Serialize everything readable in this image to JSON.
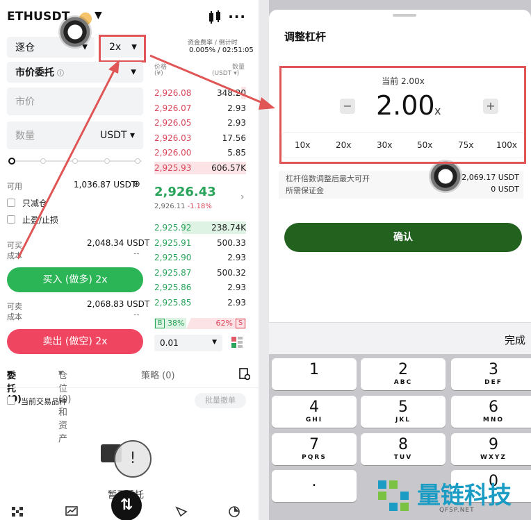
{
  "left": {
    "symbol": "ETHUSDT",
    "margin_mode": "逐仓",
    "leverage": "2x",
    "order_type": "市价委托",
    "funding_label": "资金费率 / 倒计时",
    "funding_value": "0.005% / 02:51:05",
    "price_placeholder": "市价",
    "qty_placeholder": "数量",
    "qty_unit": "USDT",
    "available_label": "可用",
    "available_value": "1,036.87 USDT",
    "reduce_only": "只减仓",
    "tpsl": "止盈/止损",
    "can_buy_label": "可买",
    "can_buy_value": "2,048.34 USDT",
    "cost_label_1": "成本",
    "cost_value_1": "--",
    "buy_button": "买入 (做多) 2x",
    "can_sell_label": "可卖",
    "can_sell_value": "2,068.83 USDT",
    "cost_label_2": "成本",
    "cost_value_2": "--",
    "sell_button": "卖出 (做空) 2x",
    "orderbook": {
      "price_header": "价格",
      "price_unit": "(¥)",
      "qty_header": "数量",
      "qty_unit": "(USDT ▾)",
      "asks": [
        {
          "price": "2,926.08",
          "qty": "348.20",
          "fill": 0.05
        },
        {
          "price": "2,926.07",
          "qty": "2.93",
          "fill": 0.0
        },
        {
          "price": "2,926.05",
          "qty": "2.93",
          "fill": 0.0
        },
        {
          "price": "2,926.03",
          "qty": "17.56",
          "fill": 0.0
        },
        {
          "price": "2,926.00",
          "qty": "5.85",
          "fill": 0.0
        },
        {
          "price": "2,925.93",
          "qty": "606.57K",
          "fill": 1.0
        }
      ],
      "mid_price": "2,926.43",
      "mark_price": "2,926.11",
      "change_pct": "-1.18%",
      "bids": [
        {
          "price": "2,925.92",
          "qty": "238.74K",
          "fill": 0.7
        },
        {
          "price": "2,925.91",
          "qty": "500.33",
          "fill": 0.0
        },
        {
          "price": "2,925.90",
          "qty": "2.93",
          "fill": 0.0
        },
        {
          "price": "2,925.87",
          "qty": "500.32",
          "fill": 0.0
        },
        {
          "price": "2,925.86",
          "qty": "2.93",
          "fill": 0.0
        },
        {
          "price": "2,925.85",
          "qty": "2.93",
          "fill": 0.0
        }
      ],
      "buy_tag": "B",
      "buy_ratio": "38%",
      "sell_ratio": "62%",
      "sell_tag": "S",
      "precision": "0.01"
    },
    "tabs": {
      "orders": "委托 (0)",
      "positions": "仓位 (0) 和资产",
      "strategy": "策略 (0)"
    },
    "current_symbol_only": "当前交易品种",
    "batch_cancel": "批量撤单",
    "empty_text": "暂无委托"
  },
  "right": {
    "title": "调整杠杆",
    "current_label": "当前 2.00x",
    "value": "2.00",
    "unit": "x",
    "minus": "−",
    "plus": "+",
    "presets": [
      "10x",
      "20x",
      "30x",
      "50x",
      "75x",
      "100x"
    ],
    "max_label": "杠杆倍数调整后最大可开",
    "max_value": "2,069.17 USDT",
    "margin_label": "所需保证金",
    "margin_value": "0 USDT",
    "confirm": "确认",
    "done": "完成",
    "keys": [
      {
        "n": "1",
        "l": ""
      },
      {
        "n": "2",
        "l": "ABC"
      },
      {
        "n": "3",
        "l": "DEF"
      },
      {
        "n": "4",
        "l": "GHI"
      },
      {
        "n": "5",
        "l": "JKL"
      },
      {
        "n": "6",
        "l": "MNO"
      },
      {
        "n": "7",
        "l": "PQRS"
      },
      {
        "n": "8",
        "l": "TUV"
      },
      {
        "n": "9",
        "l": "WXYZ"
      },
      {
        "n": ".",
        "l": ""
      },
      {
        "n": "0",
        "l": ""
      }
    ]
  },
  "watermark": {
    "brand": "量链科技",
    "site": "QFSP.NET"
  },
  "colors": {
    "buy": "#2bb557",
    "sell": "#ef4560",
    "confirm": "#23611f",
    "annotation": "#e05555",
    "watermark": "#1b9cc4"
  }
}
